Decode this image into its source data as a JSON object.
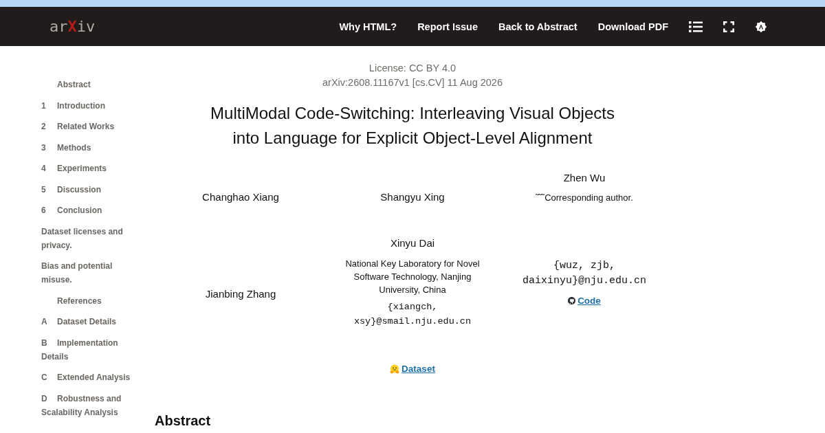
{
  "header": {
    "logo": "arXiv",
    "links": [
      {
        "label": "Why HTML?"
      },
      {
        "label": "Report Issue"
      },
      {
        "label": "Back to Abstract"
      },
      {
        "label": "Download PDF"
      }
    ],
    "tools": [
      {
        "kind": "toc"
      },
      {
        "kind": "fullscreen"
      },
      {
        "kind": "theme"
      }
    ]
  },
  "toc": {
    "items": [
      {
        "kind": "unnumbered",
        "title": "Abstract"
      },
      {
        "kind": "numbered",
        "number": "1",
        "title": "Introduction"
      },
      {
        "kind": "numbered",
        "number": "2",
        "title": "Related Works"
      },
      {
        "kind": "numbered",
        "number": "3",
        "title": "Methods"
      },
      {
        "kind": "numbered",
        "number": "4",
        "title": "Experiments"
      },
      {
        "kind": "numbered",
        "number": "5",
        "title": "Discussion"
      },
      {
        "kind": "numbered",
        "number": "6",
        "title": "Conclusion"
      },
      {
        "kind": "plain",
        "title": "Dataset licenses and privacy."
      },
      {
        "kind": "plain",
        "title": "Bias and potential misuse."
      },
      {
        "kind": "unnumbered",
        "title": "References"
      },
      {
        "kind": "numbered",
        "number": "A",
        "title": "Dataset Details"
      },
      {
        "kind": "numbered",
        "number": "B",
        "title": "Implementation Details"
      },
      {
        "kind": "numbered",
        "number": "C",
        "title": "Extended Analysis"
      },
      {
        "kind": "numbered",
        "number": "D",
        "title": "Robustness and Scalability Analysis"
      }
    ]
  },
  "front": {
    "license": "License: CC BY 4.0",
    "identifier": "arXiv:2608.11167v1 [cs.CV] 11 Aug 2026",
    "title": "MultiModal Code-Switching: Interleaving Visual Objects into Language for Explicit Object-Level Alignment",
    "author_cells": [
      {
        "name": "Changhao Xiang"
      },
      {
        "name": "Shangyu Xing"
      },
      {
        "name": "Zhen Wu",
        "note": "˜˜˜Corresponding author."
      },
      {
        "name": "Jianbing Zhang"
      },
      {
        "name": "Xinyu Dai",
        "affiliation": "National Key Laboratory for Novel Software Technology, Nanjing University, China",
        "email": "{xiangch, xsy}@smail.nju.edu.cn"
      },
      {
        "email": "{wuz, zjb, daixinyu}@nju.edu.cn",
        "link": {
          "kind": "code",
          "label": "Code"
        }
      }
    ],
    "links": [
      {
        "kind": "dataset",
        "label": "Dataset"
      }
    ],
    "section_heading": "Abstract"
  }
}
